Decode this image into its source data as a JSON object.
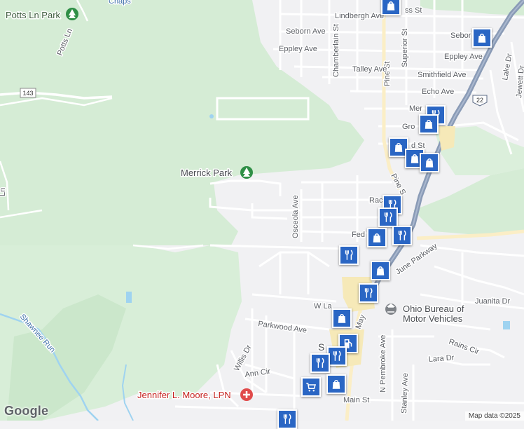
{
  "map": {
    "places": {
      "potts_ln_park": "Potts Ln Park",
      "merrick_park": "Merrick Park",
      "ohio_bmv_line1": "Ohio Bureau of",
      "ohio_bmv_line2": "Motor Vehicles",
      "jennifer_moore": "Jennifer L. Moore, LPN",
      "town_partial": "S"
    },
    "roads": {
      "chaps": "Chaps",
      "potts_ln": "Potts Ln",
      "route_143": "143",
      "route_22": "22",
      "lindbergh_ave": "Lindbergh Ave",
      "ss_st": "ss St",
      "seborn_ave": "Seborn Ave",
      "seborn_ave_right": "Sebor",
      "eppley_ave": "Eppley Ave",
      "eppley_ave_right": "Eppley Ave",
      "chamberlain_st": "Chamberlain St",
      "pine_st": "Pine St",
      "superior_st": "Superior St",
      "talley_ave": "Talley Ave",
      "smithfield_ave": "Smithfield Ave",
      "echo_ave": "Echo Ave",
      "mer_partial": "Mer",
      "gro_partial": "Gro",
      "d_st_partial": "d St",
      "pine_s_partial": "Pine S",
      "lake_dr": "Lake Dr",
      "jewett_partial": "Jewett Dr",
      "osceola_ave": "Osceola Ave",
      "rac_partial": "Rac",
      "fed_partial": "Fed",
      "june_parkway": "June Parkway",
      "juanita_dr": "Juanita Dr",
      "w_la_partial": "W La",
      "parkwood_ave": "Parkwood Ave",
      "willis_dr": "Willis Dr",
      "ann_cir": "Ann Cir",
      "shawnee_run": "Shawnee Run",
      "n_pembroke_ave": "N Pembroke Ave",
      "stanley_ave": "Stanley Ave",
      "rains_cir": "Rains Cir",
      "lara_dr": "Lara Dr",
      "main_st": "Main St",
      "may_partial": "May",
      "ln_partial": "Ln"
    },
    "markers": [
      {
        "type": "shopping"
      },
      {
        "type": "shopping"
      },
      {
        "type": "restaurant"
      },
      {
        "type": "shopping"
      },
      {
        "type": "shopping"
      },
      {
        "type": "shopping"
      },
      {
        "type": "shopping"
      },
      {
        "type": "restaurant"
      },
      {
        "type": "restaurant"
      },
      {
        "type": "shopping"
      },
      {
        "type": "restaurant"
      },
      {
        "type": "restaurant"
      },
      {
        "type": "shopping"
      },
      {
        "type": "restaurant"
      },
      {
        "type": "shopping"
      },
      {
        "type": "gas"
      },
      {
        "type": "restaurant"
      },
      {
        "type": "restaurant"
      },
      {
        "type": "shopping"
      },
      {
        "type": "grocery"
      },
      {
        "type": "restaurant"
      }
    ],
    "colors": {
      "park": "#d5ecd5",
      "park_dark": "#c3e5c3",
      "water": "#9fd3f0",
      "highway": "#8a9bb6",
      "marker": "#2a66c4"
    },
    "logo": "Google",
    "attribution": "Map data ©2025"
  }
}
